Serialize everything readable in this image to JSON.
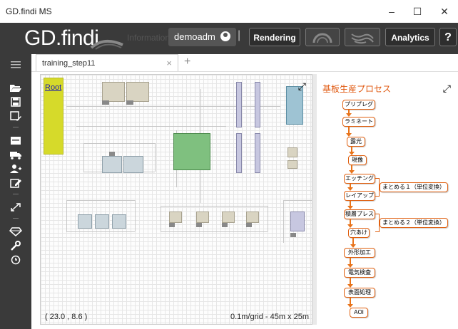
{
  "window": {
    "title": "GD.findi MS",
    "minimize": "–",
    "maximize": "☐",
    "close": "✕"
  },
  "toolbar": {
    "brand": "GD.findi",
    "info_label": "Information",
    "user": "demoadm",
    "separator": "|",
    "rendering_label": "Rendering",
    "analytics_label": "Analytics",
    "help_label": "?"
  },
  "sidebar": {
    "icons": [
      "menu-icon",
      "folder-open-icon",
      "save-icon",
      "save-as-icon",
      "layout-icon",
      "truck-icon",
      "add-user-icon",
      "edit-icon",
      "expand-icon",
      "diamond-icon",
      "wrench-icon",
      "clock-icon"
    ]
  },
  "tabs": [
    {
      "label": "training_step11",
      "close": "×"
    }
  ],
  "add_tab": "+",
  "canvas": {
    "root_label": "Root",
    "coords": "( 23.0 , 8.6 )",
    "scale": "0.1m/grid - 45m x 25m",
    "expand": "⤢"
  },
  "process_panel": {
    "title": "基板生産プロセス",
    "expand": "⤢",
    "steps": [
      "プリプレグ",
      "ラミネート",
      "露光",
      "現像",
      "エッチング",
      "レイアップ",
      "積層プレス",
      "穴あけ",
      "外形加工",
      "電気検査",
      "表面処理",
      "AOI"
    ],
    "groups": [
      "まとめる１（単位変換）",
      "まとめる２（単位変換）"
    ]
  },
  "colors": {
    "toolbar_bg": "#3a3a3a",
    "accent_orange": "#e06010",
    "root_block": "#d6da2a",
    "green_block": "#7fc07f",
    "blue_block": "#9ec3d3",
    "lavender_block": "#c7c7e0"
  }
}
